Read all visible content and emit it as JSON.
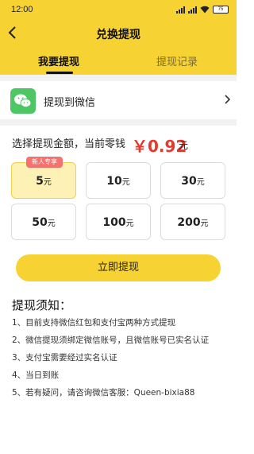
{
  "status": {
    "time": "12:00",
    "battery": "75"
  },
  "header": {
    "title": "兑换提现"
  },
  "tabs": [
    {
      "label": "我要提现",
      "active": true
    },
    {
      "label": "提现记录",
      "active": false
    }
  ],
  "withdraw_method": {
    "label": "提现到微信"
  },
  "balance": {
    "prefix": "选择提现金额，当前零钱",
    "amount": "￥0.92",
    "unit": "元"
  },
  "amounts": [
    {
      "value": "5",
      "unit": "元",
      "selected": true,
      "badge": "新人专享"
    },
    {
      "value": "10",
      "unit": "元",
      "selected": false
    },
    {
      "value": "30",
      "unit": "元",
      "selected": false
    },
    {
      "value": "50",
      "unit": "元",
      "selected": false
    },
    {
      "value": "100",
      "unit": "元",
      "selected": false
    },
    {
      "value": "200",
      "unit": "元",
      "selected": false
    }
  ],
  "submit": {
    "label": "立即提现"
  },
  "notice": {
    "title": "提现须知：",
    "items": [
      "1、目前支持微信红包和支付宝两种方式提现",
      "2、微信提现须绑定微信账号，且微信账号已实名认证",
      "3、支付宝需要经过实名认证",
      "4、当日到账",
      "5、若有疑问，请咨询微信客服：Queen-bixia88"
    ]
  },
  "colors": {
    "accent": "#f6d233",
    "price": "#e23a2c",
    "wechat": "#4cc764",
    "badge": "#f4716d"
  }
}
